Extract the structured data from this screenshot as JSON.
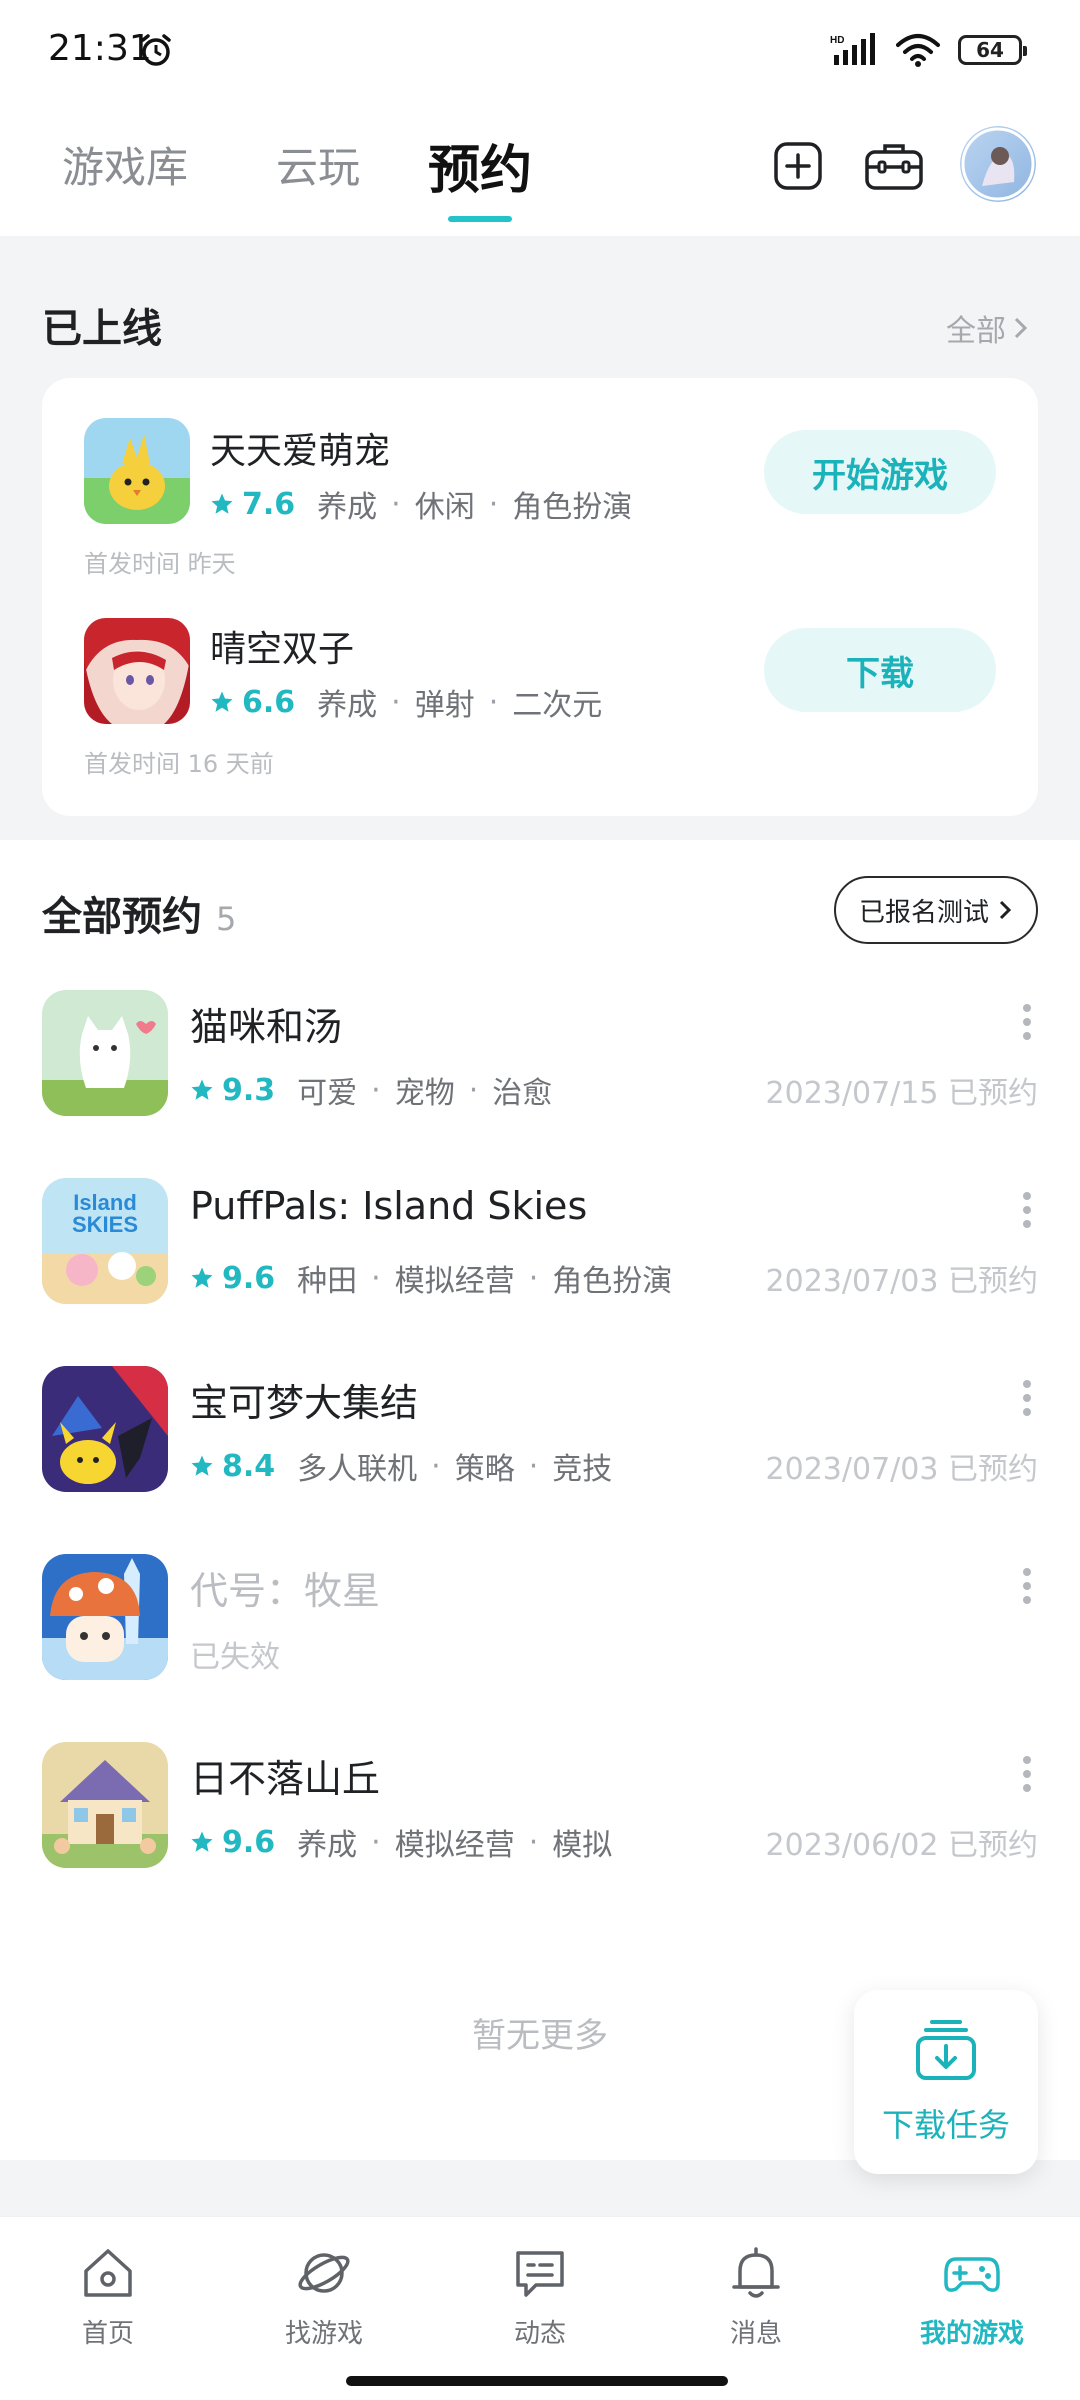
{
  "status_bar": {
    "time": "21:31",
    "battery": "64"
  },
  "top_tabs": [
    {
      "label": "游戏库",
      "active": false
    },
    {
      "label": "云玩",
      "active": false
    },
    {
      "label": "预约",
      "active": true
    }
  ],
  "launched": {
    "title": "已上线",
    "all_label": "全部",
    "games": [
      {
        "name": "天天爱萌宠",
        "score": "7.6",
        "tags": [
          "养成",
          "休闲",
          "角色扮演"
        ],
        "release": "首发时间 昨天",
        "action": "开始游戏",
        "icon": "chick-pet-icon"
      },
      {
        "name": "晴空双子",
        "score": "6.6",
        "tags": [
          "养成",
          "弹射",
          "二次元"
        ],
        "release": "首发时间 16 天前",
        "action": "下载",
        "icon": "red-hair-girl-icon"
      }
    ]
  },
  "reservations": {
    "title": "全部预约",
    "count": "5",
    "test_button": "已报名测试",
    "items": [
      {
        "name": "猫咪和汤",
        "score": "9.3",
        "tags": [
          "可爱",
          "宠物",
          "治愈"
        ],
        "date": "2023/07/15 已预约",
        "icon": "white-cat-icon"
      },
      {
        "name": "PuffPals: Island Skies",
        "score": "9.6",
        "tags": [
          "种田",
          "模拟经营",
          "角色扮演"
        ],
        "date": "2023/07/03 已预约",
        "icon": "puffpals-icon"
      },
      {
        "name": "宝可梦大集结",
        "score": "8.4",
        "tags": [
          "多人联机",
          "策略",
          "竞技"
        ],
        "date": "2023/07/03 已预约",
        "icon": "pokemon-unite-icon"
      },
      {
        "name": "代号：牧星",
        "status": "已失效",
        "icon": "mushroom-icon"
      },
      {
        "name": "日不落山丘",
        "score": "9.6",
        "tags": [
          "养成",
          "模拟经营",
          "模拟"
        ],
        "date": "2023/06/02 已预约",
        "icon": "cottage-icon"
      }
    ],
    "no_more": "暂无更多"
  },
  "download_tasks": "下载任务",
  "bottom_nav": [
    {
      "label": "首页",
      "icon": "home-icon"
    },
    {
      "label": "找游戏",
      "icon": "planet-icon"
    },
    {
      "label": "动态",
      "icon": "chat-icon"
    },
    {
      "label": "消息",
      "icon": "bell-icon"
    },
    {
      "label": "我的游戏",
      "icon": "gamepad-icon",
      "active": true
    }
  ],
  "colors": {
    "accent": "#22b8c2",
    "pill_bg": "#e6f7f8",
    "page_bg": "#f3f4f6"
  }
}
